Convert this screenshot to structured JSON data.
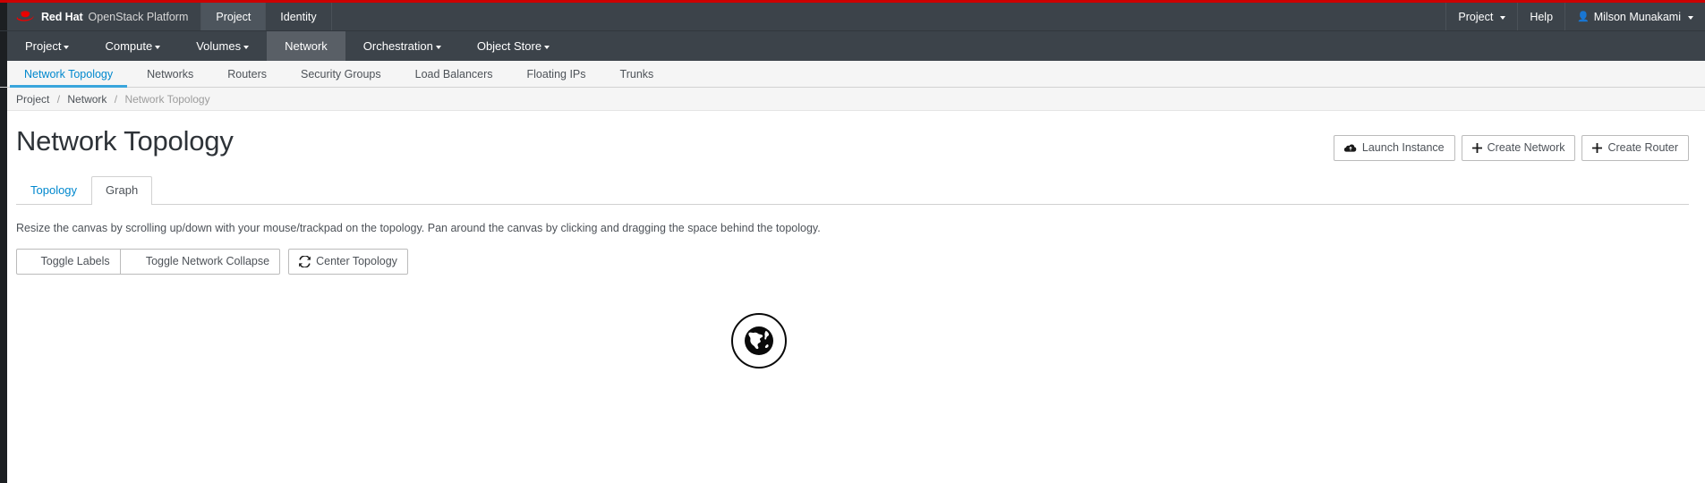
{
  "masthead": {
    "brand_bold": "Red Hat",
    "brand_light": "OpenStack Platform",
    "tabs": [
      {
        "label": "Project",
        "active": true
      },
      {
        "label": "Identity",
        "active": false
      }
    ],
    "right_items": [
      {
        "label": "Project",
        "has_caret": true,
        "icon": null
      },
      {
        "label": "Help",
        "has_caret": false,
        "icon": null
      },
      {
        "label": "Milson Munakami",
        "has_caret": true,
        "icon": "user-icon"
      }
    ]
  },
  "primary_nav": {
    "items": [
      {
        "label": "Project",
        "has_caret": true,
        "active": false
      },
      {
        "label": "Compute",
        "has_caret": true,
        "active": false
      },
      {
        "label": "Volumes",
        "has_caret": true,
        "active": false
      },
      {
        "label": "Network",
        "has_caret": false,
        "active": true
      },
      {
        "label": "Orchestration",
        "has_caret": true,
        "active": false
      },
      {
        "label": "Object Store",
        "has_caret": true,
        "active": false
      }
    ]
  },
  "secondary_nav": {
    "items": [
      {
        "label": "Network Topology",
        "active": true
      },
      {
        "label": "Networks",
        "active": false
      },
      {
        "label": "Routers",
        "active": false
      },
      {
        "label": "Security Groups",
        "active": false
      },
      {
        "label": "Load Balancers",
        "active": false
      },
      {
        "label": "Floating IPs",
        "active": false
      },
      {
        "label": "Trunks",
        "active": false
      }
    ]
  },
  "breadcrumb": {
    "items": [
      "Project",
      "Network",
      "Network Topology"
    ],
    "separator": "/"
  },
  "page": {
    "title": "Network Topology"
  },
  "actions": {
    "launch_instance": "Launch Instance",
    "create_network": "Create Network",
    "create_router": "Create Router"
  },
  "tabs": [
    {
      "label": "Topology",
      "active": false
    },
    {
      "label": "Graph",
      "active": true
    }
  ],
  "hint": "Resize the canvas by scrolling up/down with your mouse/trackpad on the topology. Pan around the canvas by clicking and dragging the space behind the topology.",
  "toolbar": {
    "toggle_labels": "Toggle Labels",
    "toggle_network_collapse": "Toggle Network Collapse",
    "center_topology": "Center Topology"
  },
  "canvas": {
    "nodes": [
      {
        "type": "external-network",
        "icon": "globe-icon"
      }
    ]
  },
  "colors": {
    "accent_red": "#cc0000",
    "link_blue": "#0088ce",
    "tab_underline": "#39a5dc",
    "nav_dark": "#3c434a",
    "nav_active": "#595f66"
  }
}
